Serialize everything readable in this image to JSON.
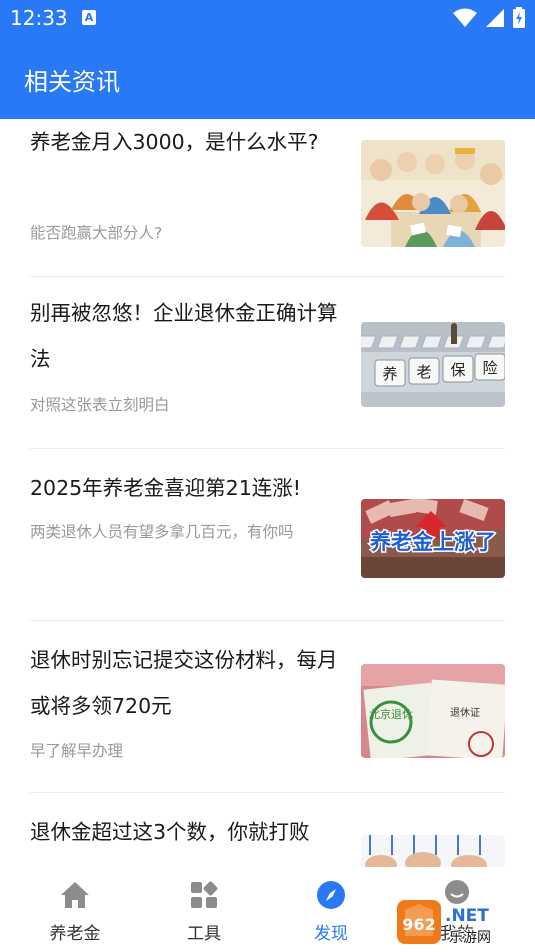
{
  "status": {
    "time": "12:33",
    "notif_icon_letter": "A"
  },
  "header": {
    "title": "相关资讯"
  },
  "articles": [
    {
      "title": "养老金月入3000，是什么水平?",
      "subtitle": "能否跑赢大部分人?"
    },
    {
      "title": "别再被忽悠！企业退休金正确计算法",
      "subtitle": "对照这张表立刻明白"
    },
    {
      "title": "2025年养老金喜迎第21连涨!",
      "subtitle": "两类退休人员有望多拿几百元，有你吗"
    },
    {
      "title": "退休时别忘记提交这份材料，每月或将多领720元",
      "subtitle": "早了解早办理"
    },
    {
      "title": "退休金超过这3个数，你就打败",
      "subtitle": ""
    }
  ],
  "thumb_text": {
    "keys": [
      "养",
      "老",
      "保",
      "险"
    ],
    "banner": "养老金上涨了",
    "cert_green": "北京退休",
    "cert_label": "退休证"
  },
  "tabs": [
    {
      "label": "养老金",
      "icon": "home-icon",
      "active": false
    },
    {
      "label": "工具",
      "icon": "grid-tools-icon",
      "active": false
    },
    {
      "label": "发现",
      "icon": "compass-icon",
      "active": true
    },
    {
      "label": "我的",
      "icon": "profile-icon",
      "active": false
    }
  ],
  "watermark": {
    "brand": "962",
    "suffix": ".NET",
    "site": "乐游网"
  },
  "colors": {
    "accent": "#2979f7",
    "text": "#1a1a1a",
    "muted": "#999999",
    "divider": "#ededed"
  }
}
